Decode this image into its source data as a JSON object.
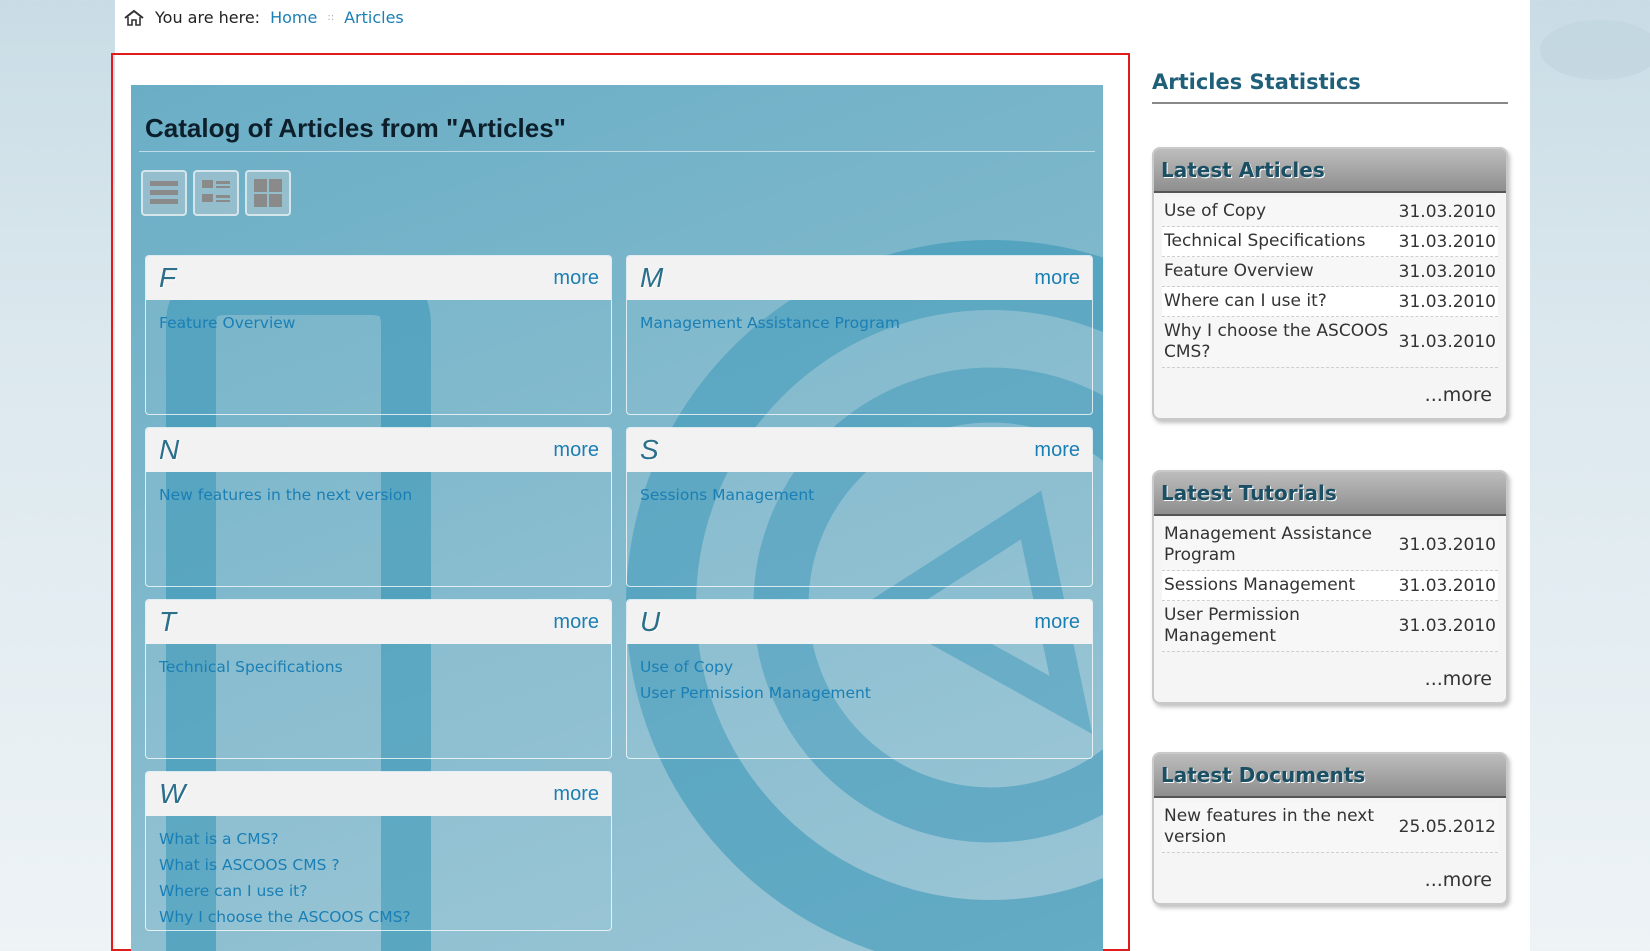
{
  "breadcrumb": {
    "prefix": "You are here:",
    "items": [
      "Home",
      "Articles"
    ],
    "separator": "::"
  },
  "catalog": {
    "title": "Catalog of Articles from \"Articles\"",
    "view_buttons": [
      "list-view-icon",
      "detail-view-icon",
      "grid-view-icon"
    ],
    "more_label": "more",
    "groups": [
      {
        "letter": "F",
        "links": [
          "Feature Overview"
        ]
      },
      {
        "letter": "M",
        "links": [
          "Management Assistance Program"
        ]
      },
      {
        "letter": "N",
        "links": [
          "New features in the next version"
        ]
      },
      {
        "letter": "S",
        "links": [
          "Sessions Management"
        ]
      },
      {
        "letter": "T",
        "links": [
          "Technical Specifications"
        ]
      },
      {
        "letter": "U",
        "links": [
          "Use of Copy",
          "User Permission Management"
        ]
      },
      {
        "letter": "W",
        "links": [
          "What is a CMS?",
          "What is ASCOOS CMS ?",
          "Where can I use it?",
          "Why I choose the ASCOOS CMS?"
        ]
      }
    ]
  },
  "sidebar": {
    "title": "Articles Statistics",
    "more_label": "...more",
    "boxes": [
      {
        "title": "Latest Articles",
        "rows": [
          {
            "title": "Use of Copy",
            "date": "31.03.2010"
          },
          {
            "title": "Technical Specifications",
            "date": "31.03.2010"
          },
          {
            "title": "Feature Overview",
            "date": "31.03.2010"
          },
          {
            "title": "Where can I use it?",
            "date": "31.03.2010"
          },
          {
            "title": "Why I choose the ASCOOS CMS?",
            "date": "31.03.2010"
          }
        ]
      },
      {
        "title": "Latest Tutorials",
        "rows": [
          {
            "title": "Management Assistance Program",
            "date": "31.03.2010"
          },
          {
            "title": "Sessions Management",
            "date": "31.03.2010"
          },
          {
            "title": "User Permission Management",
            "date": "31.03.2010"
          }
        ]
      },
      {
        "title": "Latest Documents",
        "rows": [
          {
            "title": "New features in the next version",
            "date": "25.05.2012"
          }
        ]
      }
    ]
  },
  "colors": {
    "accent": "#1a7fb5",
    "frame": "#e01b1b",
    "catalog_bg": "#7db7cb"
  }
}
